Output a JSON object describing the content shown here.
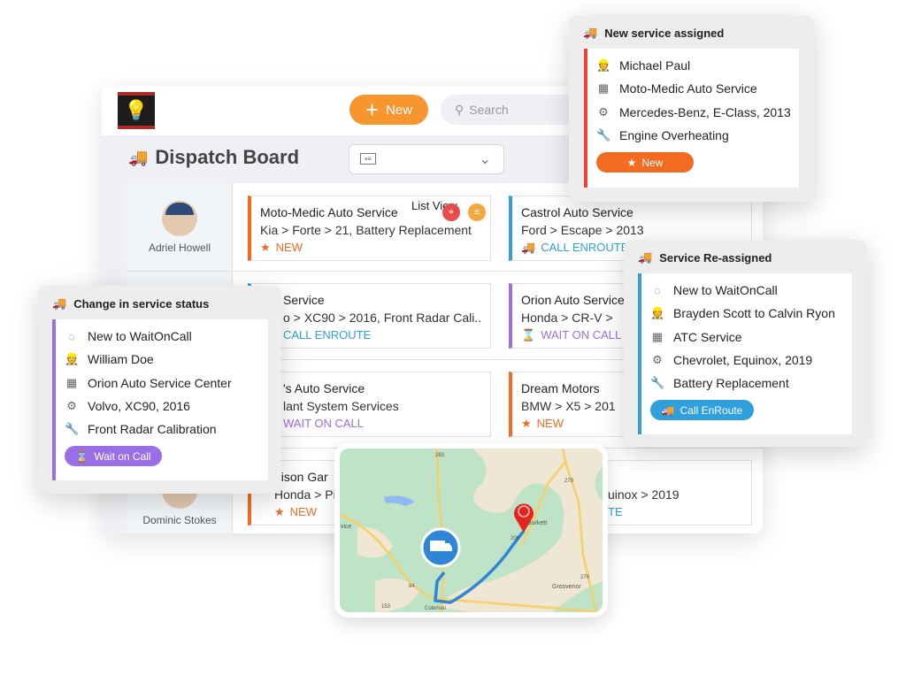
{
  "header": {
    "new_label": "New",
    "search_placeholder": "Search",
    "title": "Dispatch Board",
    "list_view_label": "List View"
  },
  "colors": {
    "new": "#f26b21",
    "enroute": "#2fa0dc",
    "waiting": "#9a6ee6",
    "assigned": "#f0413f",
    "primary": "#f7952e"
  },
  "technicians": [
    {
      "name": "Adriel Howell"
    },
    {
      "name": "Dominic Stokes"
    }
  ],
  "cards": [
    {
      "title": "Moto-Medic Auto Service",
      "make": "Kia",
      "model": "Forte",
      "detail": "21, Battery Replacement",
      "status": "NEW"
    },
    {
      "title": "Castrol Auto Service",
      "make": "Ford",
      "model": "Escape",
      "detail": "2013",
      "status": "CALL ENROUTE"
    },
    {
      "title": "Service",
      "make": "o",
      "model": "XC90",
      "detail": "2016, Front Radar Cali..",
      "status": "CALL ENROUTE"
    },
    {
      "title": "Orion Auto Service",
      "make": "Honda",
      "model": "CR-V",
      "detail": "",
      "status": "WAIT ON CALL"
    },
    {
      "title": "'s Auto Service",
      "line2": "lant System Services",
      "status": "WAIT ON CALL"
    },
    {
      "title": "Dream Motors",
      "make": "BMW",
      "model": "X5",
      "detail": "201",
      "status": "NEW"
    },
    {
      "title": "dison Gar",
      "make": "Honda",
      "model": "Pilo",
      "status": "NEW"
    },
    {
      "model": "uinox",
      "detail": "2019",
      "status": "TE"
    }
  ],
  "popups": {
    "assigned": {
      "title": "New service assigned",
      "technician": "Michael Paul",
      "shop": "Moto-Medic Auto Service",
      "vehicle": "Mercedes-Benz, E-Class, 2013",
      "issue": "Engine Overheating",
      "badge": "New"
    },
    "status": {
      "title": "Change in service status",
      "change": "New to WaitOnCall",
      "technician": "William Doe",
      "shop": "Orion Auto Service Center",
      "vehicle": "Volvo, XC90, 2016",
      "issue": "Front Radar Calibration",
      "badge": "Wait on Call"
    },
    "reassigned": {
      "title": "Service Re-assigned",
      "change": "New to WaitOnCall",
      "technician": "Brayden Scott to Calvin Ryon",
      "shop": "ATC Service",
      "vehicle": "Chevrolet, Equinox, 2019",
      "issue": "Battery Replacement",
      "badge": "Call EnRoute"
    }
  },
  "map": {
    "labels": [
      "283",
      "84",
      "153",
      "206",
      "279",
      "279",
      "Burkett",
      "Grosvenor",
      "Coleman",
      "vice"
    ]
  }
}
